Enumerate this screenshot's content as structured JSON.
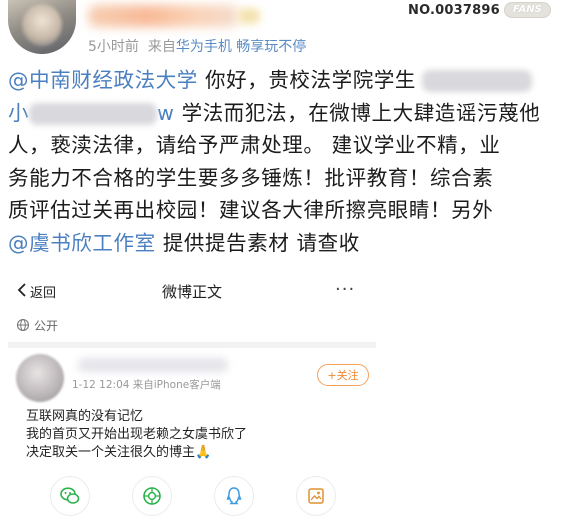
{
  "post": {
    "time": "5小时前",
    "source_prefix": "来自",
    "source_name": "华为手机 畅享玩不停",
    "fans_no": "NO.0037896",
    "fans_tag": "FANS",
    "lines": {
      "l1_mention": "@中南财经政法大学",
      "l1_text": " 你好，贵校法学院学生",
      "l2_mention_start": "小",
      "l2_mention_end": "w",
      "l2_text": " 学法而犯法，在微博上大肆造谣污蔑他",
      "l3": "人，亵渎法律，请给予严肃处理。 建议学业不精，业",
      "l4": "务能力不合格的学生要多多锤炼！批评教育！综合素",
      "l5": "质评估过关再出校园！建议各大律所擦亮眼睛！另外",
      "l6_mention": "@虞书欣工作室",
      "l6_text": " 提供提告素材 请查收"
    }
  },
  "embed": {
    "back_label": "返回",
    "title": "微博正文",
    "more": "···",
    "visibility": "公开",
    "meta": "1-12 12:04  来自iPhone客户端",
    "follow_label": "+关注",
    "body": [
      "互联网真的没有记忆",
      "我的首页又开始出现老赖之女虞书欣了",
      "决定取关一个关注很久的博主🙏"
    ]
  },
  "colors": {
    "link": "#4a7fc0",
    "follow": "#f08a33",
    "meta": "#9a9a9a"
  }
}
